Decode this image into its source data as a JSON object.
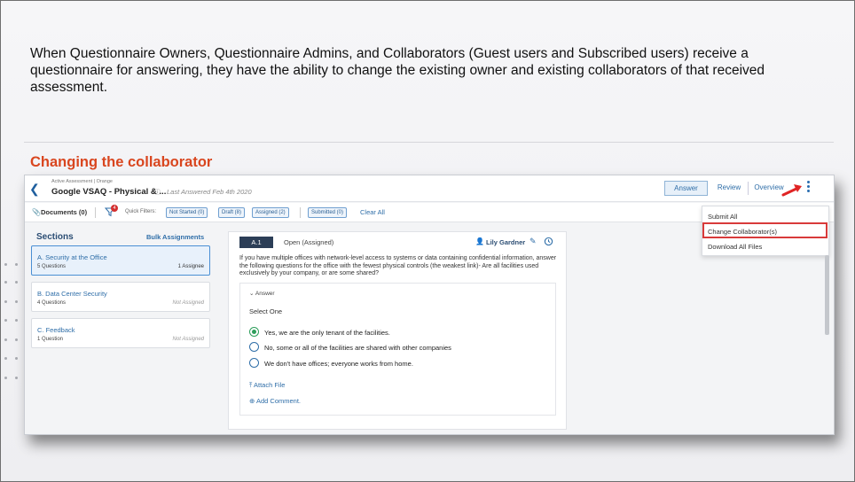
{
  "slide": {
    "intro": "When Questionnaire Owners, Questionnaire Admins, and Collaborators (Guest users and Subscribed users) receive a questionnaire for answering, they have the ability to change the existing owner and existing collaborators of that received assessment.",
    "heading": "Changing the collaborator"
  },
  "app": {
    "breadcrumb": "Active Assessment | Orange",
    "title": "Google VSAQ - Physical & ...",
    "last_answered": "Last Answered Feb 4th 2020",
    "tabs": {
      "answer": "Answer",
      "review": "Review",
      "overview": "Overview"
    },
    "accent_color": "#2f6ea8",
    "highlight_color": "#d83a3a"
  },
  "filters": {
    "documents": "Documents (0)",
    "filter_badge": "4",
    "quick_filters_label": "Quick Filters:",
    "chips": [
      "Not Started (0)",
      "Draft (8)",
      "Assigned (2)",
      "Submitted (0)"
    ],
    "clear_all": "Clear All"
  },
  "sections": {
    "title": "Sections",
    "bulk": "Bulk Assignments",
    "items": [
      {
        "name": "A. Security at the Office",
        "count": "5 Questions",
        "status": "1 Assignee"
      },
      {
        "name": "B. Data Center Security",
        "count": "4 Questions",
        "status": "Not Assigned"
      },
      {
        "name": "C. Feedback",
        "count": "1 Question",
        "status": "Not Assigned"
      }
    ]
  },
  "question": {
    "id": "A.1",
    "status": "Open (Assigned)",
    "assignee": "Lily Gardner",
    "text": "If you have multiple offices with network-level access to systems or data containing confidential information, answer the following questions for the office with the fewest physical controls (the weakest link)- Are all facilities used exclusively by your company, or are some shared?",
    "answer_toggle": "Answer",
    "select_label": "Select One",
    "options": [
      "Yes, we are the only tenant of the facilities.",
      "No, some or all of the facilities are shared with other companies",
      "We don't have offices; everyone works from home."
    ],
    "selected_option": "Yes, we are the only tenant of the facilities.",
    "attach": "Attach File",
    "comment": "Add Comment."
  },
  "menu": {
    "items": [
      "Submit All",
      "Change Collaborator(s)",
      "Download All Files"
    ]
  }
}
